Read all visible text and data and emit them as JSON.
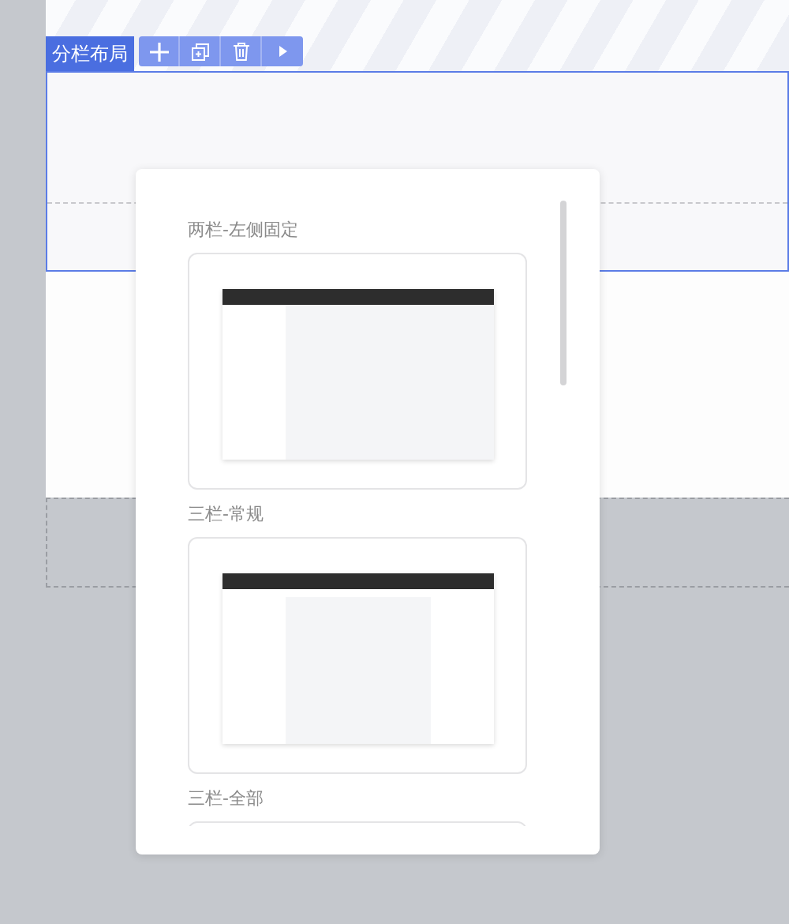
{
  "block_tag": {
    "label": "分栏布局"
  },
  "toolbar": [
    {
      "kind": "add"
    },
    {
      "kind": "copy"
    },
    {
      "kind": "delete"
    },
    {
      "kind": "more"
    }
  ],
  "layout_picker": {
    "options": [
      {
        "label": "两栏-左侧固定",
        "kind": "left-fixed"
      },
      {
        "label": "三栏-常规",
        "kind": "three-column"
      },
      {
        "label": "三栏-全部",
        "kind": "cut"
      }
    ]
  }
}
